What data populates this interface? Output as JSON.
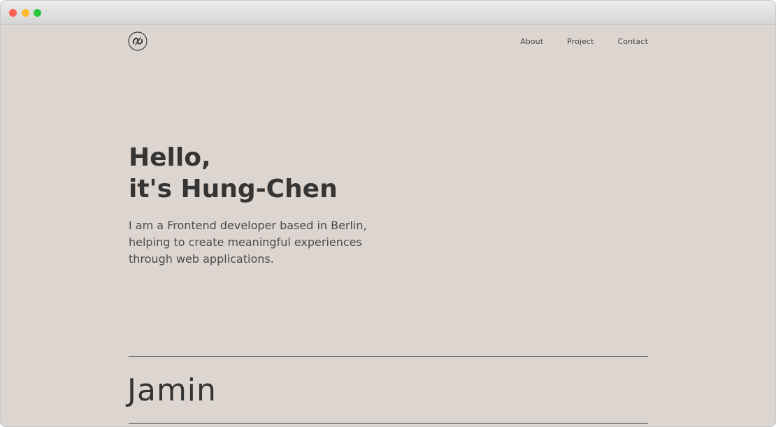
{
  "window": {
    "controls": [
      "close",
      "minimize",
      "maximize"
    ]
  },
  "header": {
    "logo_icon": "circled-monogram-logo",
    "nav": [
      {
        "label": "About"
      },
      {
        "label": "Project"
      },
      {
        "label": "Contact"
      }
    ]
  },
  "hero": {
    "title_line1": "Hello,",
    "title_line2": "it's Hung-Chen",
    "subtitle_line1": "I am a Frontend developer based in Berlin,",
    "subtitle_line2": "helping to create meaningful experiences",
    "subtitle_line3": "through web applications."
  },
  "projects": [
    {
      "name": "Jamin"
    }
  ],
  "colors": {
    "background": "#ddd5d0",
    "text": "#353535",
    "divider": "#3a3a3a"
  }
}
